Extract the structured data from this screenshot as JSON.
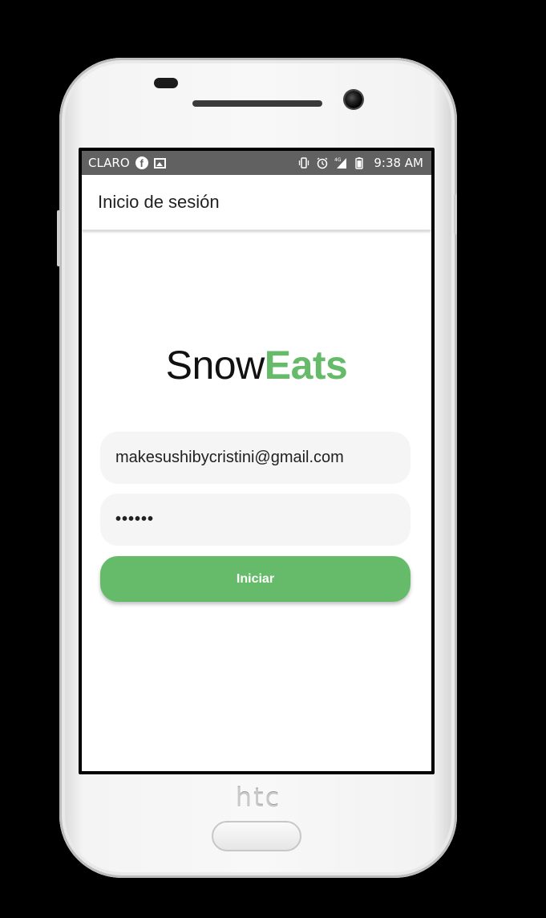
{
  "status_bar": {
    "carrier": "CLARO",
    "time": "9:38 AM",
    "left_icons": [
      "facebook-icon",
      "image-icon"
    ],
    "right_icons": [
      "vibrate-icon",
      "alarm-icon",
      "signal-4g-icon",
      "battery-icon"
    ]
  },
  "app_bar": {
    "title": "Inicio de sesión"
  },
  "logo": {
    "part1": "Snow",
    "part2": "Eats"
  },
  "form": {
    "email_value": "makesushibycristini@gmail.com",
    "password_value": "••••••",
    "submit_label": "Iniciar"
  },
  "device": {
    "brand": "htc"
  },
  "colors": {
    "accent": "#66bb6a",
    "status_bar": "#616161",
    "field_bg": "#f5f5f5"
  }
}
